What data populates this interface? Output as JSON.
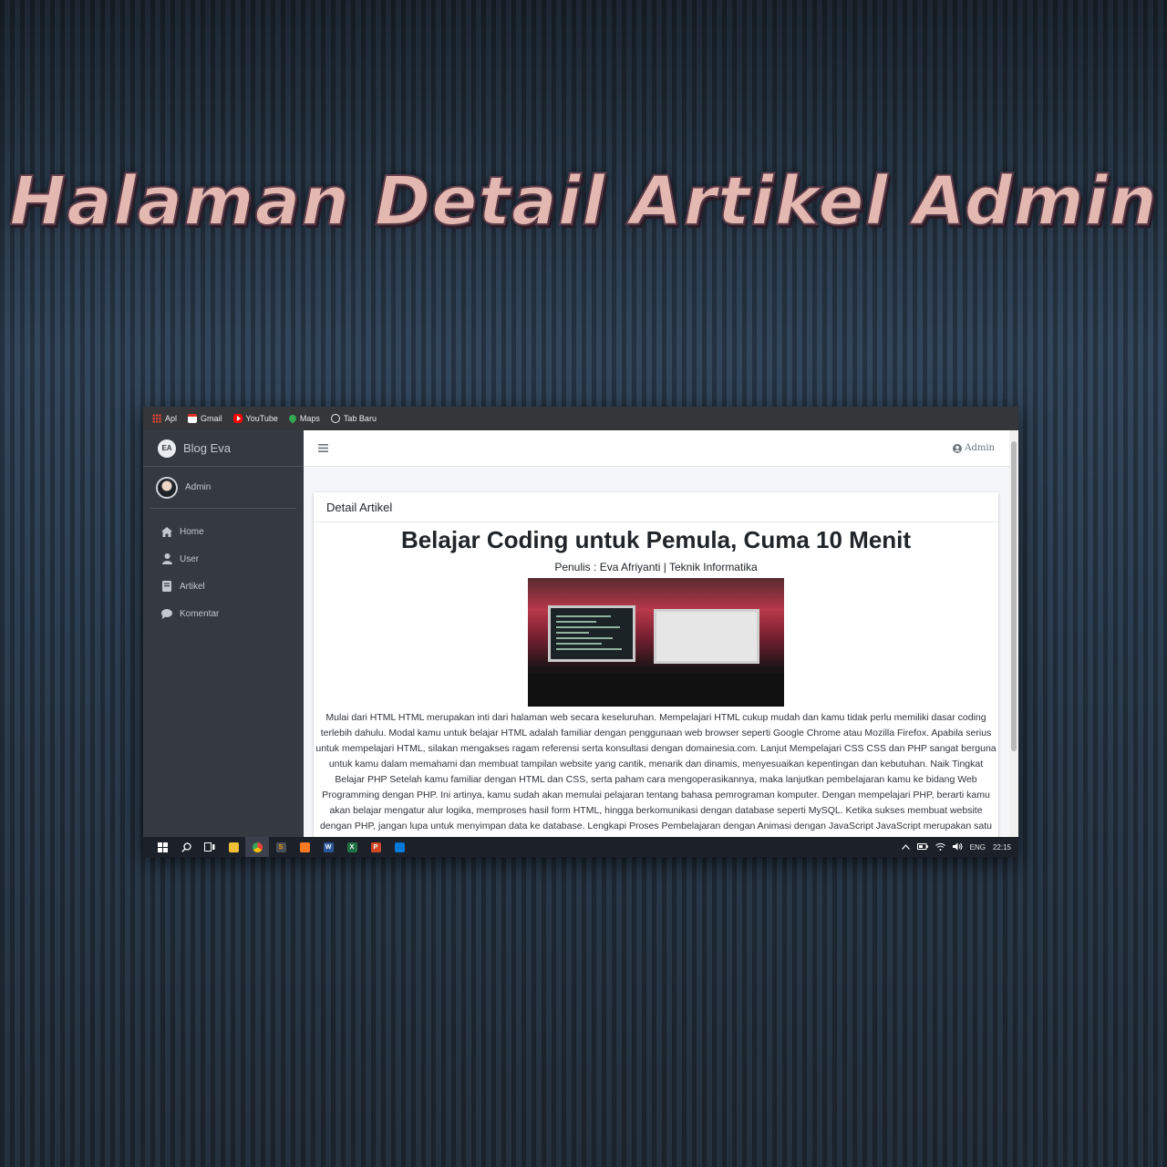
{
  "banner": {
    "title": "Halaman Detail Artikel Admin"
  },
  "bookmarks": [
    {
      "label": "Apl",
      "icon": "apps-grid-icon",
      "color": "#f4b400"
    },
    {
      "label": "Gmail",
      "icon": "gmail-icon",
      "color": "#d93025"
    },
    {
      "label": "YouTube",
      "icon": "youtube-icon",
      "color": "#ff0000"
    },
    {
      "label": "Maps",
      "icon": "maps-pin-icon",
      "color": "#34a853"
    },
    {
      "label": "Tab Baru",
      "icon": "globe-icon",
      "color": "#e8eaed"
    }
  ],
  "sidebar": {
    "brand_logo": "EA",
    "brand": "Blog Eva",
    "user": "Admin",
    "items": [
      {
        "label": "Home",
        "icon": "home-icon"
      },
      {
        "label": "User",
        "icon": "user-icon"
      },
      {
        "label": "Artikel",
        "icon": "book-icon"
      },
      {
        "label": "Komentar",
        "icon": "comment-icon"
      }
    ]
  },
  "topnav": {
    "menu_icon": "hamburger-icon",
    "user_label": "Admin",
    "user_icon": "user-circle-icon"
  },
  "card": {
    "header": "Detail Artikel",
    "title": "Belajar Coding untuk Pemula, Cuma 10 Menit",
    "meta": "Penulis : Eva Afriyanti | Teknik Informatika",
    "image_alt": "coding workspace photo",
    "body": "Mulai dari HTML HTML merupakan inti dari halaman web secara keseluruhan. Mempelajari HTML cukup mudah dan kamu tidak perlu memiliki dasar coding terlebih dahulu. Modal kamu untuk belajar HTML adalah familiar dengan penggunaan web browser seperti Google Chrome atau Mozilla Firefox. Apabila serius untuk mempelajari HTML, silakan mengakses ragam referensi serta konsultasi dengan domainesia.com. Lanjut Mempelajari CSS CSS dan PHP sangat berguna untuk kamu dalam memahami dan membuat tampilan website yang cantik, menarik dan dinamis, menyesuaikan kepentingan dan kebutuhan. Naik Tingkat Belajar PHP Setelah kamu familiar dengan HTML dan CSS, serta paham cara mengoperasikannya, maka lanjutkan pembelajaran kamu ke bidang Web Programming dengan PHP. Ini artinya, kamu sudah akan memulai pelajaran tentang bahasa pemrograman komputer. Dengan mempelajari PHP, berarti kamu akan belajar mengatur alur logika, memproses hasil form HTML, hingga berkomunikasi dengan database seperti MySQL. Ketika sukses membuat website dengan PHP, jangan lupa untuk menyimpan data ke database. Lengkapi Proses Pembelajaran dengan Animasi dengan JavaScript JavaScript merupakan satu golongan dengan PHP yaitu merupakan bahasa pemrograman murni. JavaScript akan membuat halaman web kamu tampil interaktif serta membuat visual lebih artistik."
  },
  "taskbar": {
    "apps": [
      "windows-start-icon",
      "search-icon",
      "task-view-icon",
      "file-explorer-icon",
      "chrome-icon",
      "sublime-icon",
      "xampp-icon",
      "word-icon",
      "excel-icon",
      "powerpoint-icon",
      "store-icon"
    ],
    "app_letters": {
      "word": "W",
      "excel": "X",
      "powerpoint": "P"
    },
    "language": "ENG",
    "time": "22:15"
  }
}
